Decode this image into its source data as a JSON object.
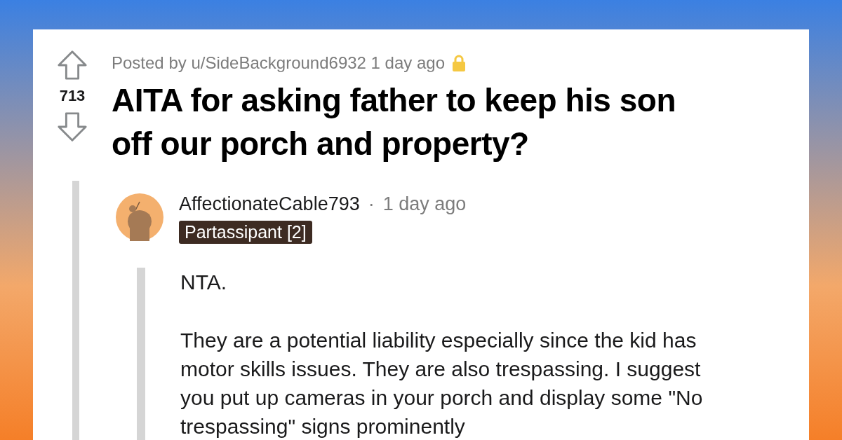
{
  "post": {
    "score": "713",
    "byline": "Posted by u/SideBackground6932 1 day ago",
    "locked": true,
    "title": "AITA for asking father to keep his son off our porch and property?"
  },
  "comment": {
    "author": "AffectionateCable793",
    "separator": "·",
    "time": "1 day ago",
    "flair": "Partassipant [2]",
    "paragraphs": [
      "NTA.",
      "They are a potential liability especially since the kid has motor skills issues. They are also trespassing. I suggest you put up cameras in your porch and display some \"No trespassing\" signs prominently"
    ]
  }
}
